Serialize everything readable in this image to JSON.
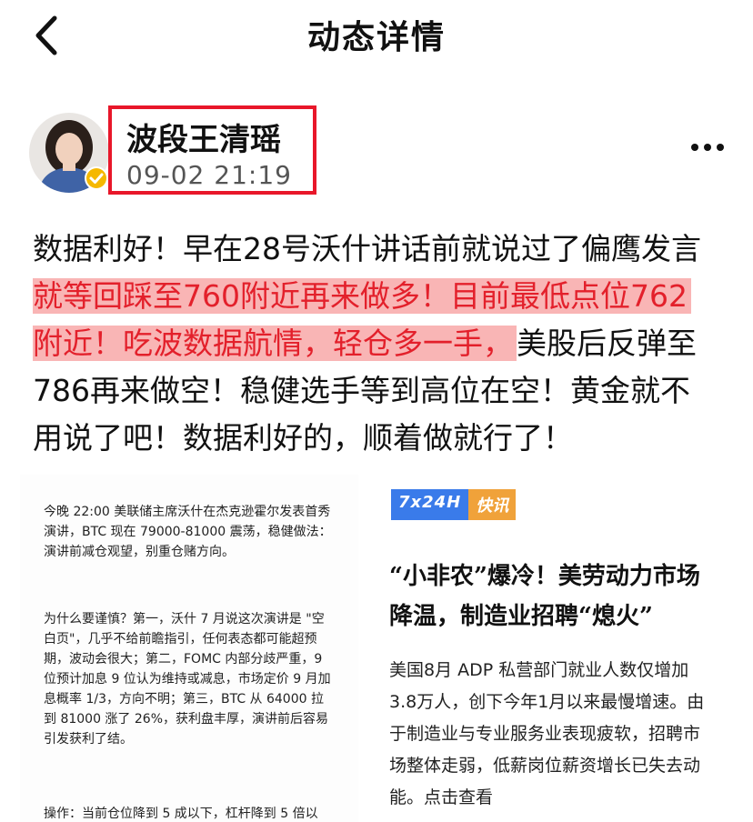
{
  "nav": {
    "title": "动态详情"
  },
  "author": {
    "name": "波段王清瑶",
    "time": "09-02 21:19"
  },
  "post": {
    "lines": [
      "数据利好！早在28号沃什讲话前就说过了偏鹰发言",
      "就等回踩至760附近再来做多！目前最低点位762",
      "附近！吃波数据航情，轻仓多一手，",
      "美股后反弹至",
      "786再来做空！稳健选手等到高位在空！黄金就不",
      "用说了吧！数据利好的，顺着做就行了！"
    ]
  },
  "image_left": {
    "p1": [
      "今晚 22:00 美联储主席沃什在杰克逊霍尔发表首秀",
      "演讲，BTC 现在 79000-81000 震荡，稳健做法：",
      "演讲前减仓观望，别重仓赌方向。"
    ],
    "p2": [
      "为什么要谨慎？第一，沃什 7 月说这次演讲是 \"空",
      "白页\"，几乎不给前瞻指引，任何表态都可能超预",
      "期，波动会很大；第二，FOMC 内部分歧严重，9",
      "位预计加息 9 位认为维持或减息，市场定价 9 月加",
      "息概率 1/3，方向不明；第三，BTC 从 64000 拉",
      "到 81000 涨了 26%，获利盘丰厚，演讲前后容易",
      "引发获利了结。"
    ],
    "p3": [
      "操作：当前仓位降到 5 成以下，杠杆降到 5 倍以"
    ]
  },
  "image_right": {
    "tag_a": "7x24H",
    "tag_b": "快讯",
    "title_lines": [
      "“小非农”爆冷！美劳动力市场",
      "降温，制造业招聘“熄火”"
    ],
    "body_lines": [
      "美国8月 ADP 私营部门就业人数仅增加",
      "3.8万人，创下今年1月以来最慢增速。由",
      "于制造业与专业服务业表现疲软，招聘市",
      "场整体走弱，低薪岗位薪资增长已失去动",
      "能。点击查看"
    ]
  }
}
